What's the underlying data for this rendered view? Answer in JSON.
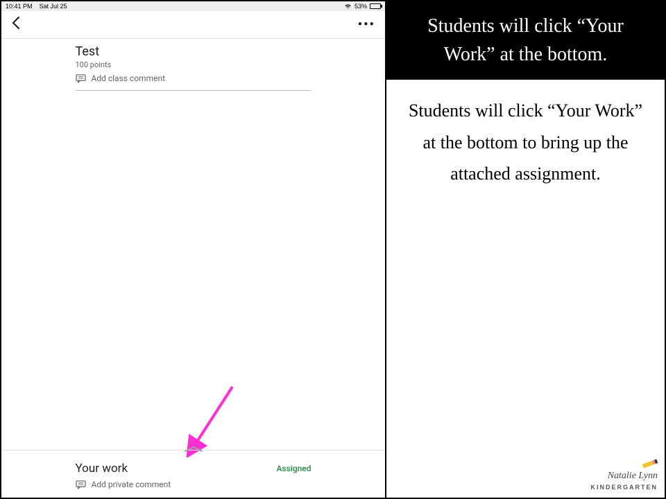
{
  "status_bar": {
    "time": "10:41 PM",
    "date": "Sat Jul 25",
    "battery_percent": "53%"
  },
  "assignment": {
    "title": "Test",
    "points": "100 points",
    "add_class_comment": "Add class comment"
  },
  "your_work": {
    "title": "Your work",
    "status": "Assigned",
    "add_private_comment": "Add private comment"
  },
  "instruction": {
    "header": "Students will click “Your Work” at the bottom.",
    "body": "Students will click “Your Work” at the bottom to bring up the attached assignment."
  },
  "watermark": {
    "line1": "Natalie Lynn",
    "line2": "KINDERGARTEN"
  }
}
